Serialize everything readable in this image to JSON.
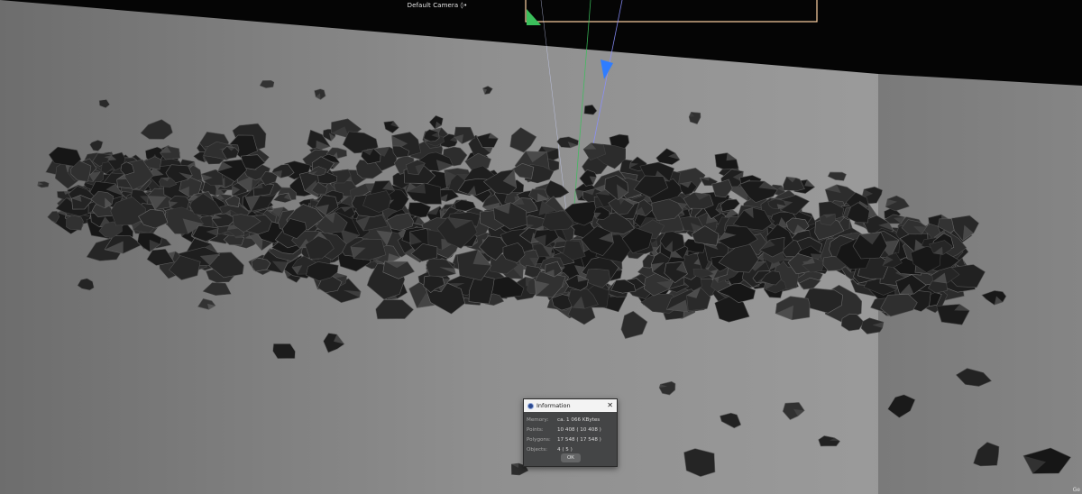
{
  "viewport": {
    "camera_label": "Default Camera ◊•",
    "corner_label": "Ge"
  },
  "info_dialog": {
    "title": "Information",
    "close_glyph": "✕",
    "rows": [
      {
        "label": "Memory:",
        "value": "ca. 1 066 KBytes"
      },
      {
        "label": "Points:",
        "value": "10 408 ( 10 408 )"
      },
      {
        "label": "Polygons:",
        "value": "17 548 ( 17 548 )"
      },
      {
        "label": "Objects:",
        "value": "4 ( 5 )"
      }
    ],
    "ok_label": "OK"
  },
  "colors": {
    "wall": "#8a8a8a",
    "floor": "#7a7a7a",
    "rock_dark": "#1c1c1c",
    "rock_light": "#5a5a5a",
    "gizmo_blue": "#2f7dff",
    "gizmo_green": "#3bbf5b",
    "frame_orange": "#ffd3a3"
  }
}
